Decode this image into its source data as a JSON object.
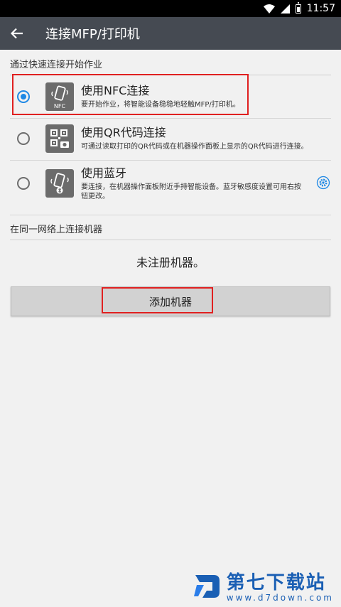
{
  "status_bar": {
    "time": "11:57",
    "icons": [
      "wifi-icon",
      "signal-icon",
      "battery-icon"
    ]
  },
  "app_bar": {
    "title": "连接MFP/打印机",
    "back_icon": "arrow-left-icon"
  },
  "quick_connect": {
    "header": "通过快速连接开始作业",
    "options": [
      {
        "icon": "nfc-phone-icon",
        "icon_label": "NFC",
        "title": "使用NFC连接",
        "desc": "要开始作业，将智能设备稳稳地轻触MFP/打印机。",
        "selected": true
      },
      {
        "icon": "qr-code-camera-icon",
        "title": "使用QR代码连接",
        "desc": "可通过读取打印的QR代码或在机器操作面板上显示的QR代码进行连接。",
        "selected": false
      },
      {
        "icon": "bluetooth-phone-icon",
        "title": "使用蓝牙",
        "desc": "要连接，在机器操作面板附近手持智能设备。蓝牙敏感度设置可用右按钮更改。",
        "selected": false,
        "settings_icon": "gear-icon"
      }
    ]
  },
  "same_network": {
    "header": "在同一网络上连接机器",
    "empty_message": "未注册机器。",
    "add_button_label": "添加机器"
  },
  "watermark": {
    "brand": "第七下载站",
    "url": "www.d7down.com"
  },
  "colors": {
    "app_bar": "#454a52",
    "accent": "#1e88e5",
    "highlight": "#e02020"
  }
}
